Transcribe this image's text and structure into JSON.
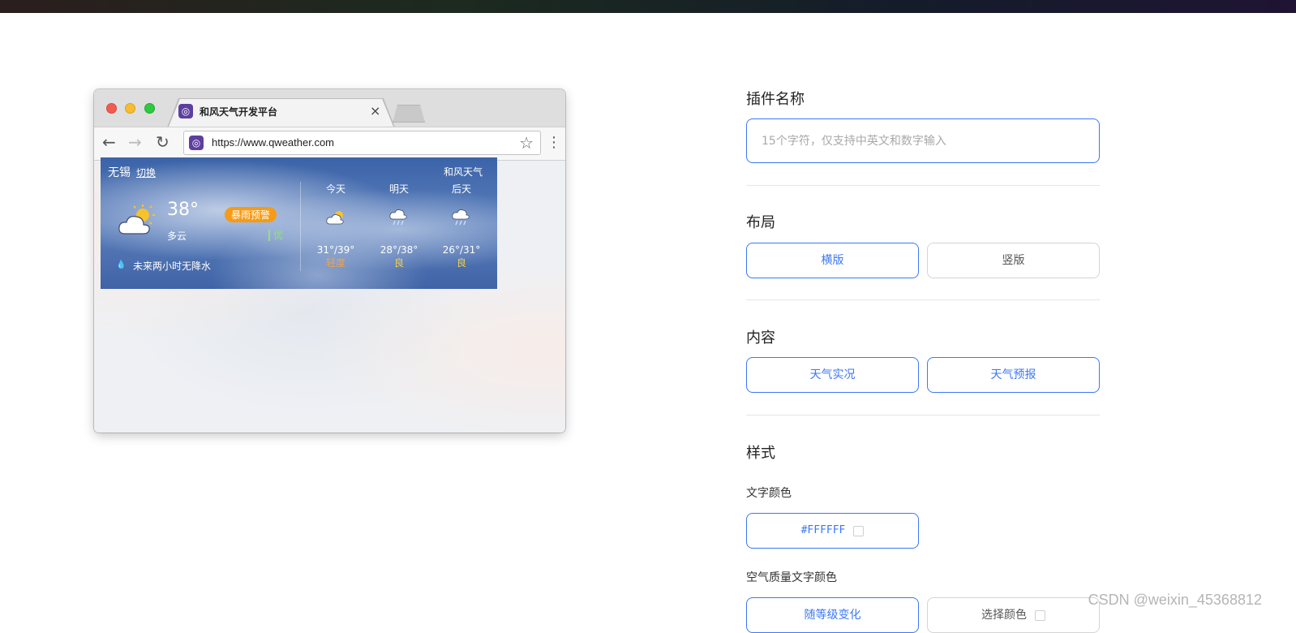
{
  "browser": {
    "tab_title": "和风天气开发平台",
    "tab_close": "×",
    "url": "https://www.qweather.com"
  },
  "widget": {
    "city": "无锡",
    "switch_label": "切换",
    "brand": "和风天气",
    "temperature": "38°",
    "condition": "多云",
    "alert": "暴雨预警",
    "aqi": "优",
    "rain_forecast": "未来两小时无降水",
    "forecast": [
      {
        "day": "今天",
        "range": "31°/39°",
        "air": "轻度",
        "icon": "partly-cloudy-icon"
      },
      {
        "day": "明天",
        "range": "28°/38°",
        "air": "良",
        "icon": "rain-cloud-icon"
      },
      {
        "day": "后天",
        "range": "26°/31°",
        "air": "良",
        "icon": "rain-cloud-icon"
      }
    ],
    "colors": {
      "alert": "#f59b16",
      "aqi": "#8fe27b",
      "air_mild": "#f0a24f",
      "air_good": "#f2d14a"
    }
  },
  "panel": {
    "name_title": "插件名称",
    "name_placeholder": "15个字符，仅支持中英文和数字输入",
    "layout_title": "布局",
    "layout_options": [
      "横版",
      "竖版"
    ],
    "content_title": "内容",
    "content_options": [
      "天气实况",
      "天气预报"
    ],
    "style_title": "样式",
    "text_color_label": "文字颜色",
    "text_color_value": "#FFFFFF",
    "aqi_color_label": "空气质量文字颜色",
    "aqi_color_options": [
      "随等级变化",
      "选择颜色"
    ],
    "accent_color": "#3b78f5"
  },
  "watermark": "CSDN @weixin_45368812"
}
